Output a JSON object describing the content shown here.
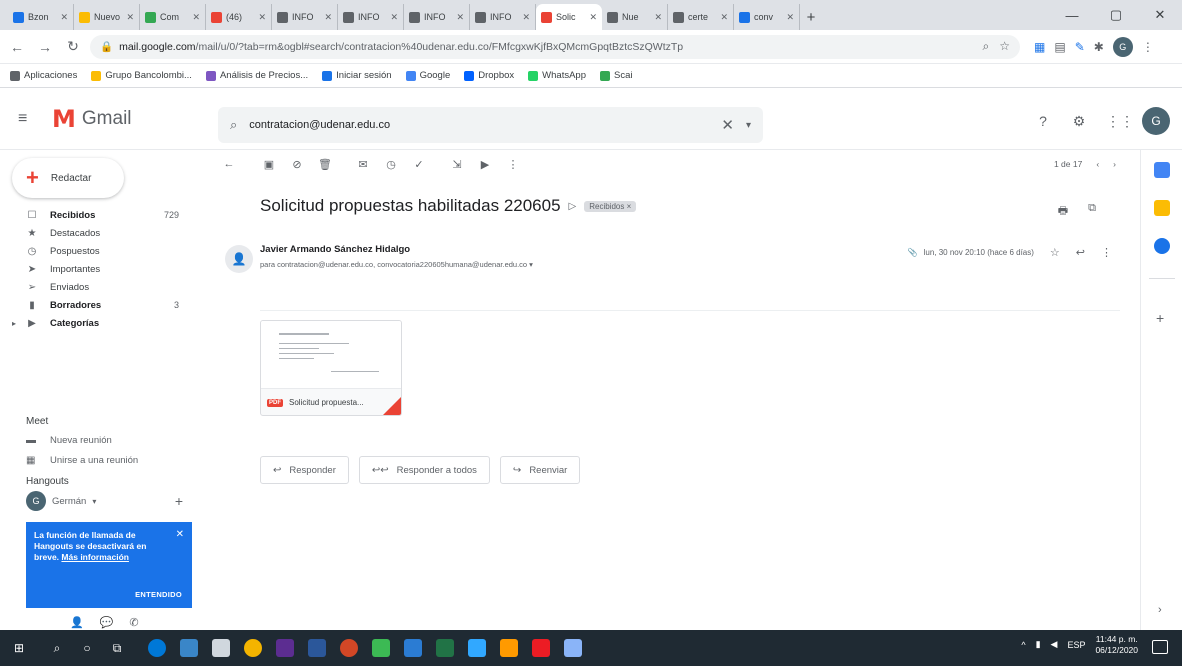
{
  "browser": {
    "tabs": [
      {
        "label": "Bzon",
        "color": "#1a73e8",
        "active": false
      },
      {
        "label": "Nuevo",
        "color": "#fbbc04",
        "active": false
      },
      {
        "label": "Com",
        "color": "#34a853",
        "active": false
      },
      {
        "label": "(46)",
        "color": "#ea4335",
        "active": false
      },
      {
        "label": "INFO",
        "color": "#5f6368",
        "active": false
      },
      {
        "label": "INFO",
        "color": "#5f6368",
        "active": false
      },
      {
        "label": "INFO",
        "color": "#5f6368",
        "active": false
      },
      {
        "label": "INFO",
        "color": "#5f6368",
        "active": false
      },
      {
        "label": "Solic",
        "color": "#ea4335",
        "active": true
      },
      {
        "label": "Nue",
        "color": "#5f6368",
        "active": false
      },
      {
        "label": "certe",
        "color": "#5f6368",
        "active": false
      },
      {
        "label": "conv",
        "color": "#1a73e8",
        "active": false
      }
    ],
    "new_tab": "+",
    "url_host": "mail.google.com",
    "url_path": "/mail/u/0/?tab=rm&ogbl#search/contratacion%40udenar.edu.co/FMfcgxwKjfBxQMcmGpqtBztcSzQWtzTp",
    "bookmarks": [
      {
        "label": "Aplicaciones",
        "color": "#5f6368"
      },
      {
        "label": "Grupo Bancolombi...",
        "color": "#fbbc04"
      },
      {
        "label": "Análisis de Precios...",
        "color": "#7e57c2"
      },
      {
        "label": "Iniciar sesión",
        "color": "#1a73e8"
      },
      {
        "label": "Google",
        "color": "#4285f4"
      },
      {
        "label": "Dropbox",
        "color": "#0061ff"
      },
      {
        "label": "WhatsApp",
        "color": "#25d366"
      },
      {
        "label": "Scai",
        "color": "#34a853"
      }
    ]
  },
  "gmail": {
    "logo_text": "Gmail",
    "search_value": "contratacion@udenar.edu.co",
    "compose_label": "Redactar",
    "nav": [
      {
        "label": "Recibidos",
        "count": "729",
        "icon": "inbox-icon",
        "glyph": "☐",
        "bold": true
      },
      {
        "label": "Destacados",
        "count": "",
        "icon": "star-icon",
        "glyph": "★",
        "bold": false
      },
      {
        "label": "Pospuestos",
        "count": "",
        "icon": "clock-icon",
        "glyph": "◷",
        "bold": false
      },
      {
        "label": "Importantes",
        "count": "",
        "icon": "important-icon",
        "glyph": "➤",
        "bold": false
      },
      {
        "label": "Enviados",
        "count": "",
        "icon": "send-icon",
        "glyph": "➢",
        "bold": false
      },
      {
        "label": "Borradores",
        "count": "3",
        "icon": "draft-icon",
        "glyph": "▮",
        "bold": true
      },
      {
        "label": "Categorías",
        "count": "",
        "icon": "label-icon",
        "glyph": "▶",
        "bold": true
      }
    ],
    "meet": {
      "title": "Meet",
      "items": [
        {
          "label": "Nueva reunión",
          "icon": "video-icon",
          "glyph": "▬"
        },
        {
          "label": "Unirse a una reunión",
          "icon": "keyboard-icon",
          "glyph": "▦"
        }
      ]
    },
    "hangouts": {
      "title": "Hangouts",
      "user": "Germán",
      "notice": "La función de llamada de Hangouts se desactivará en breve.",
      "notice_link": "Más información",
      "notice_ok": "ENTENDIDO"
    },
    "pager": "1 de 17",
    "email": {
      "subject": "Solicitud propuestas habilitadas 220605",
      "label_chip": "Recibidos ×",
      "sender": "Javier Armando Sánchez Hidalgo",
      "recipients": "para contratacion@udenar.edu.co, convocatoria220605humana@udenar.edu.co ▾",
      "date": "lun, 30 nov 20:10 (hace 6 días)",
      "attachment_name": "Solicitud propuesta...",
      "attachment_type": "PDF",
      "reply_label": "Responder",
      "reply_all_label": "Responder a todos",
      "forward_label": "Reenviar"
    }
  },
  "taskbar": {
    "tray_lang": "ESP",
    "time": "11:44 p. m.",
    "date": "06/12/2020"
  }
}
